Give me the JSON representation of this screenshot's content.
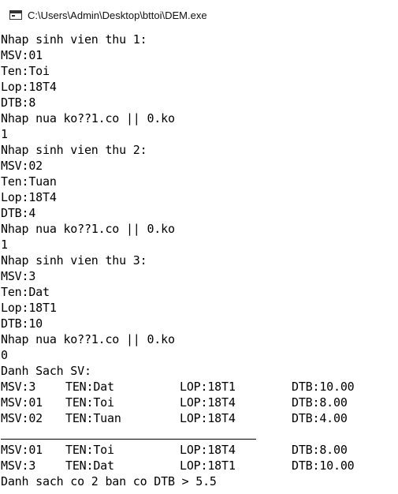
{
  "window": {
    "title": "C:\\Users\\Admin\\Desktop\\bttoi\\DEM.exe",
    "icon": "console-window-icon"
  },
  "console": {
    "lines": [
      "Nhap sinh vien thu 1:",
      "MSV:01",
      "Ten:Toi",
      "Lop:18T4",
      "DTB:8",
      "Nhap nua ko??1.co || 0.ko",
      "1",
      "Nhap sinh vien thu 2:",
      "MSV:02",
      "Ten:Tuan",
      "Lop:18T4",
      "DTB:4",
      "Nhap nua ko??1.co || 0.ko",
      "1",
      "Nhap sinh vien thu 3:",
      "MSV:3",
      "Ten:Dat",
      "Lop:18T1",
      "DTB:10",
      "Nhap nua ko??1.co || 0.ko",
      "0",
      "Danh Sach SV:"
    ],
    "list_rows": [
      [
        "MSV:3",
        "TEN:Dat",
        "LOP:18T1",
        "DTB:10.00"
      ],
      [
        "MSV:01",
        "TEN:Toi",
        "LOP:18T4",
        "DTB:8.00"
      ],
      [
        "MSV:02",
        "TEN:Tuan",
        "LOP:18T4",
        "DTB:4.00"
      ]
    ],
    "filtered_rows": [
      [
        "MSV:01",
        "TEN:Toi",
        "LOP:18T4",
        "DTB:8.00"
      ],
      [
        "MSV:3",
        "TEN:Dat",
        "LOP:18T1",
        "DTB:10.00"
      ]
    ],
    "summary": "Danh sach co 2 ban co DTB > 5.5"
  }
}
